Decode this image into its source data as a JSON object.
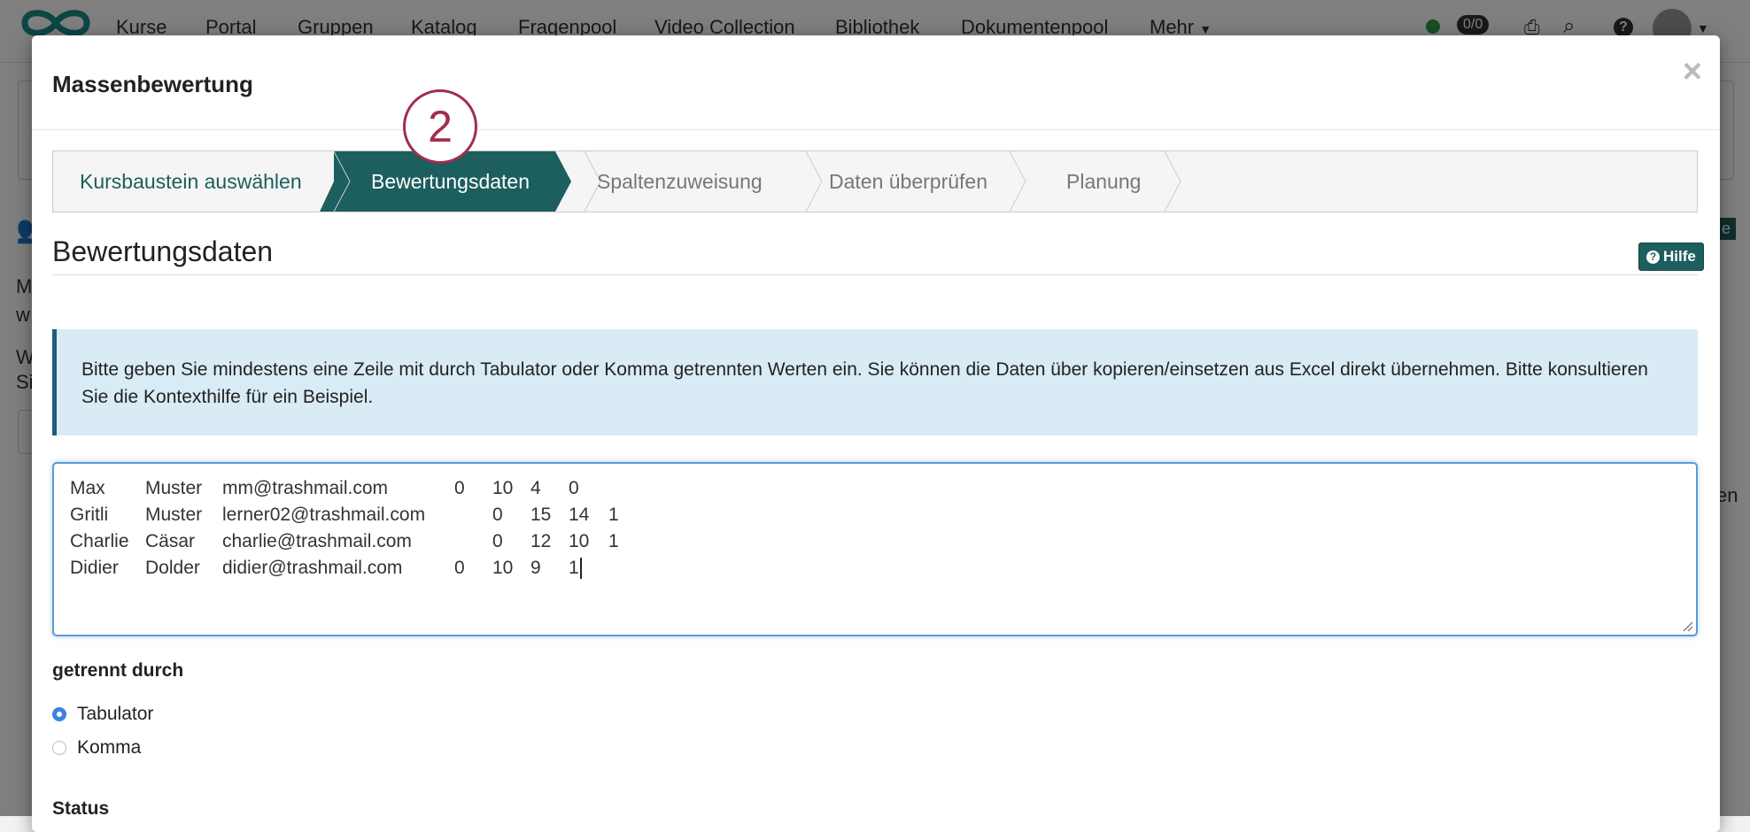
{
  "nav": {
    "items": [
      "Kurse",
      "Portal",
      "Gruppen",
      "Katalog",
      "Fragenpool",
      "Video Collection",
      "Bibliothek",
      "Dokumentenpool",
      "Mehr"
    ],
    "badge": "0/0"
  },
  "background": {
    "text_left_1": "M",
    "text_left_2": "w",
    "text_left_3": "W",
    "text_left_4": "Si",
    "text_right": "en",
    "button_right": "e"
  },
  "modal": {
    "title": "Massenbewertung",
    "close": "×"
  },
  "wizard": {
    "marker": "2",
    "steps": [
      {
        "label": "Kursbaustein auswählen",
        "state": "done"
      },
      {
        "label": "Bewertungsdaten",
        "state": "active"
      },
      {
        "label": "Spaltenzuweisung",
        "state": "todo"
      },
      {
        "label": "Daten überprüfen",
        "state": "todo"
      },
      {
        "label": "Planung",
        "state": "todo"
      }
    ]
  },
  "section": {
    "title": "Bewertungsdaten",
    "help_label": "Hilfe"
  },
  "info_text": "Bitte geben Sie mindestens eine Zeile mit durch Tabulator oder Komma getrennten Werten ein. Sie können die Daten über kopieren/einsetzen aus Excel direkt übernehmen. Bitte konsultieren Sie die Kontexthilfe für ein Beispiel.",
  "data_rows": [
    [
      "Max",
      "Muster",
      "mm@trashmail.com",
      "0",
      "10",
      "4",
      "0"
    ],
    [
      "Gritli",
      "Muster",
      "lerner02@trashmail.com",
      "0",
      "15",
      "14",
      "1"
    ],
    [
      "Charlie",
      "Cäsar",
      "charlie@trashmail.com",
      "0",
      "12",
      "10",
      "1"
    ],
    [
      "Didier",
      "Dolder",
      "didier@trashmail.com",
      "0",
      "10",
      "9",
      "1"
    ]
  ],
  "separator": {
    "label": "getrennt durch",
    "options": [
      {
        "label": "Tabulator",
        "checked": true
      },
      {
        "label": "Komma",
        "checked": false
      }
    ]
  },
  "status_label": "Status",
  "colors": {
    "accent": "#1d5e5e",
    "marker": "#a32d4e",
    "info_bg": "#d9ebf5",
    "radio": "#3b82e0"
  }
}
